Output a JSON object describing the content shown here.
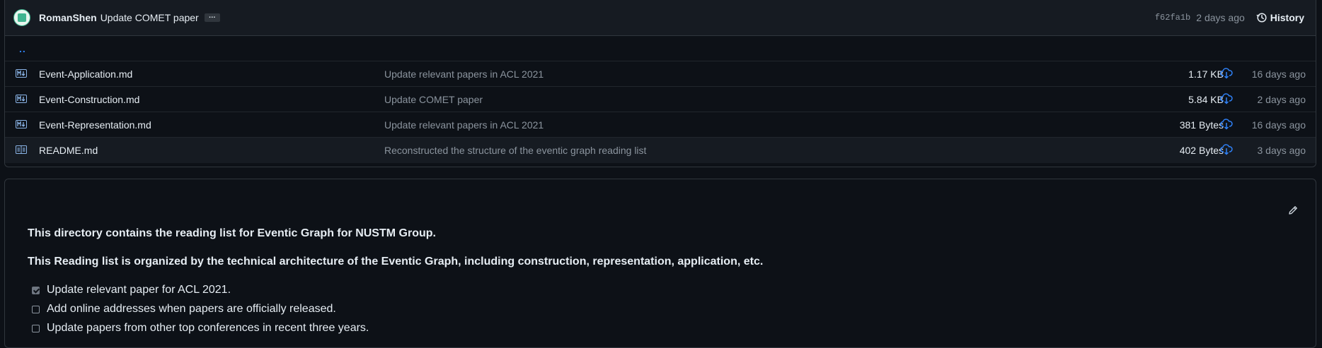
{
  "commit": {
    "author": "RomanShen",
    "message": "Update COMET paper",
    "ellipsis": "…",
    "sha": "f62fa1b",
    "time_ago": "2 days ago",
    "history_label": "History"
  },
  "parent_link": "..",
  "files": [
    {
      "name": "Event-Application.md",
      "message": "Update relevant papers in ACL 2021",
      "size": "1.17 KB",
      "age": "16 days ago",
      "icon": "markdown-icon"
    },
    {
      "name": "Event-Construction.md",
      "message": "Update COMET paper",
      "size": "5.84 KB",
      "age": "2 days ago",
      "icon": "markdown-icon"
    },
    {
      "name": "Event-Representation.md",
      "message": "Update relevant papers in ACL 2021",
      "size": "381 Bytes",
      "age": "16 days ago",
      "icon": "markdown-icon"
    },
    {
      "name": "README.md",
      "message": "Reconstructed the structure of the eventic graph reading list",
      "size": "402 Bytes",
      "age": "3 days ago",
      "icon": "readme-icon"
    }
  ],
  "readme": {
    "para1": "This directory contains the reading list for Eventic Graph for NUSTM Group.",
    "para2": "This Reading list is organized by the technical architecture of the Eventic Graph, including construction, representation, application, etc.",
    "tasks": [
      {
        "label": "Update relevant paper for ACL 2021.",
        "checked": true
      },
      {
        "label": "Add online addresses when papers are officially released.",
        "checked": false
      },
      {
        "label": "Update papers from other top conferences in recent three years.",
        "checked": false
      }
    ]
  },
  "colors": {
    "background": "#0d1117",
    "accent": "#2f81f7",
    "muted_text": "#8b949e",
    "border": "#30363d"
  }
}
